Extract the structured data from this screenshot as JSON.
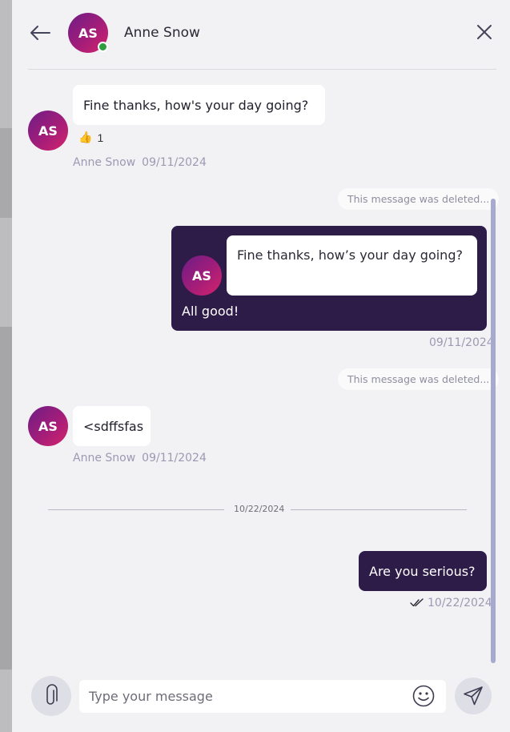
{
  "header": {
    "avatar_initials": "AS",
    "contact_name": "Anne Snow",
    "online": true
  },
  "messages": [
    {
      "direction": "in",
      "avatar_initials": "AS",
      "text": "Fine thanks, how's your day going?",
      "reaction": {
        "emoji": "👍",
        "count": "1"
      },
      "sender": "Anne Snow",
      "date": "09/11/2024"
    },
    {
      "type": "deleted",
      "text": "This message was deleted..."
    },
    {
      "direction": "out",
      "quoted": {
        "avatar_initials": "AS",
        "text": "Fine thanks, how’s your day going?"
      },
      "text": "All good!",
      "date": "09/11/2024"
    },
    {
      "type": "deleted",
      "text": "This message was deleted..."
    },
    {
      "direction": "in",
      "avatar_initials": "AS",
      "text": "<sdffsfas",
      "sender": "Anne Snow",
      "date": "09/11/2024"
    },
    {
      "type": "date-separator",
      "text": "10/22/2024"
    },
    {
      "direction": "out",
      "text": "Are you serious?",
      "date": "10/22/2024",
      "status": "read"
    }
  ],
  "composer": {
    "placeholder": "Type your message",
    "value": ""
  },
  "colors": {
    "panel_background": "#f2f2f4",
    "outgoing_bubble": "#2d1b48",
    "incoming_bubble": "#ffffff",
    "avatar_gradient_start": "#6d1d86",
    "avatar_gradient_end": "#d4236a",
    "online_indicator": "#2e9d3f",
    "meta_text": "#9c99b3",
    "scrollbar": "#a8a9cf"
  },
  "icons": {
    "back": "arrow-left-icon",
    "close": "close-icon",
    "attach": "paperclip-icon",
    "emoji": "smiley-icon",
    "send": "send-icon",
    "read_receipt": "double-check-icon",
    "reaction": "thumbs-up-icon"
  }
}
